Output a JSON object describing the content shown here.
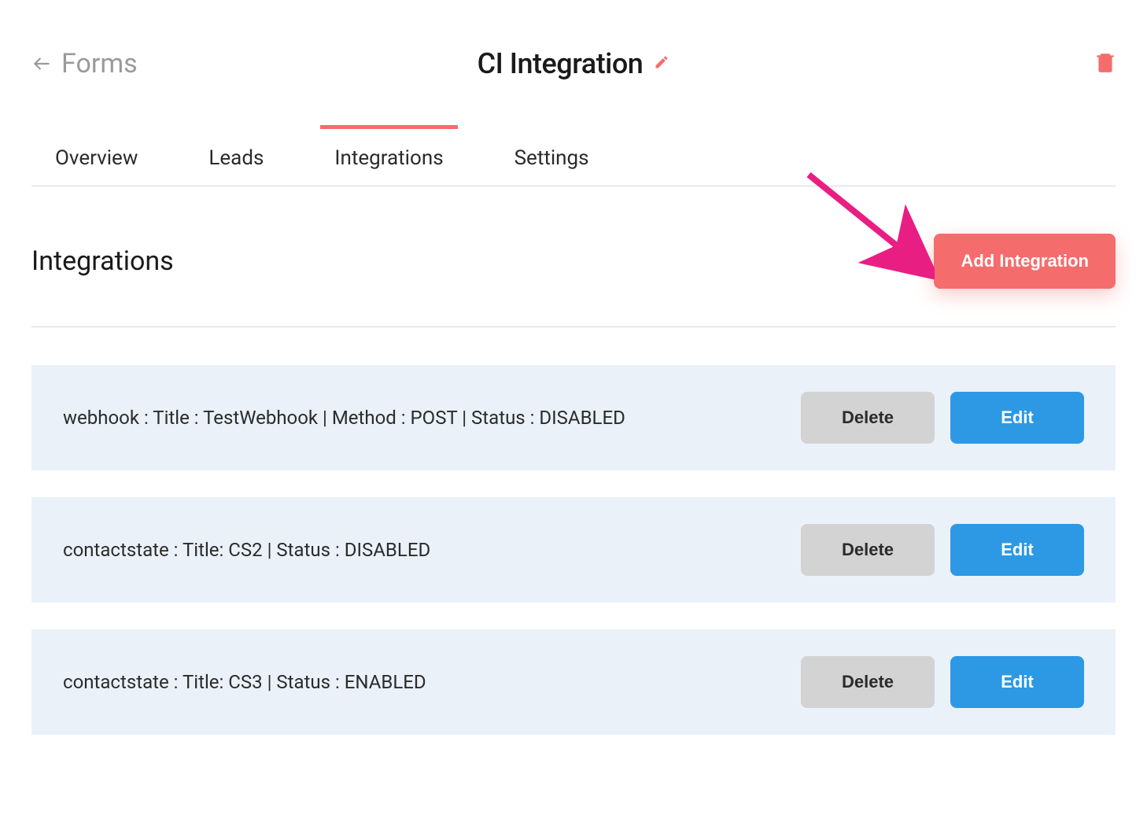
{
  "header": {
    "back_label": "Forms",
    "title": "CI Integration"
  },
  "tabs": [
    {
      "label": "Overview",
      "active": false
    },
    {
      "label": "Leads",
      "active": false
    },
    {
      "label": "Integrations",
      "active": true
    },
    {
      "label": "Settings",
      "active": false
    }
  ],
  "section": {
    "heading": "Integrations",
    "add_button": "Add Integration"
  },
  "integrations": [
    {
      "text": "webhook : Title : TestWebhook | Method : POST | Status : DISABLED"
    },
    {
      "text": "contactstate : Title: CS2 | Status : DISABLED"
    },
    {
      "text": "contactstate : Title: CS3 | Status : ENABLED"
    }
  ],
  "buttons": {
    "delete": "Delete",
    "edit": "Edit"
  },
  "colors": {
    "accent": "#f56c6c",
    "primary": "#2d99e5",
    "muted": "#d3d3d3",
    "row_bg": "#eaf1f9"
  }
}
